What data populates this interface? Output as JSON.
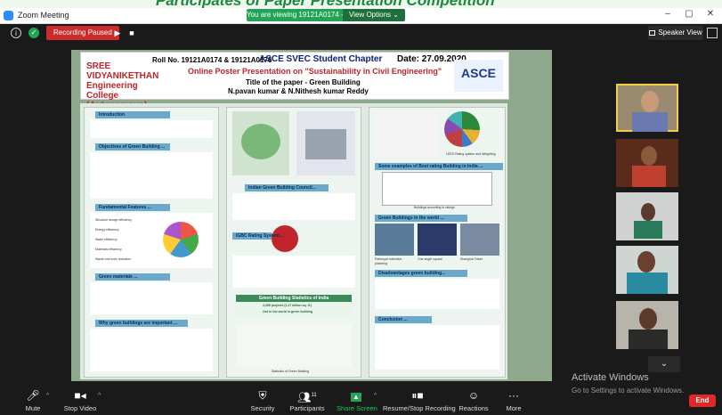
{
  "banner": {
    "text": "Participates of Paper Presentation Competition"
  },
  "titlebar": {
    "app_title": "Zoom Meeting",
    "minimize": "–",
    "restore": "▢",
    "close": "✕"
  },
  "share_bar": {
    "viewing_text": "You are viewing 19121A0174 - Pavan's screen",
    "view_options": "View Options ⌄"
  },
  "topbar": {
    "info": "i",
    "shield": "✓",
    "recording": "Recording Paused",
    "resume": "▶",
    "stop": "■",
    "speaker_view": "Speaker View"
  },
  "poster": {
    "header": {
      "logo_left": "SREE VIDYANIKETHAN Engineering College (Autonomous)",
      "roll_no": "Roll No. 19121A0174 & 19121A0176",
      "chapter": "ASCE SVEC Student Chapter",
      "date": "Date: 27.09.2020",
      "online": "Online Poster Presentation on \"Sustainability in Civil Engineering\"",
      "paper_title": "Title of the paper - Green Building",
      "authors": "N.pavan kumar & N.Nithesh kumar Reddy",
      "logo_right": "ASCE"
    },
    "sections": {
      "introduction": "Introduction",
      "objectives": "Objectives of Green Building ...",
      "fundamental": "Fundamental Features ...",
      "materials": "Green materials ...",
      "why": "Why green buildings are important ...",
      "benefits": "Benefits of green Building",
      "igbc": "Indian Green Building Council...",
      "rating": "IGBC Rating System...",
      "statistics": "Green Building Statistics of India",
      "examples": "Some examples of Best rating Building in India ...",
      "world": "Green Buildings in the world ...",
      "disadvantages": "Disadvantages green building...",
      "conclusion": "Conclusion ..."
    },
    "features": [
      "Structure design efficiency",
      "Energy efficiency",
      "Water efficiency",
      "Materials efficiency",
      "Waste and toxic reduction"
    ],
    "world_captions": [
      "Parkroyal collection pickering",
      "One angel square",
      "Shanghai Tower"
    ],
    "chart_caption": "LEED Rating system and Weighting",
    "table_caption": "Buildings according to ratings",
    "stats_line1": "4,358 projects (1.47 billion sq. ft.)",
    "stats_line2": "2nd in the world in green building",
    "stats_footer": "Statistics of Green Building"
  },
  "gallery": {
    "expand": "⌄"
  },
  "watermark": {
    "line1": "Activate Windows",
    "line2": "Go to Settings to activate Windows."
  },
  "toolbar": {
    "mute": "Mute",
    "stop_video": "Stop Video",
    "security": "Security",
    "participants": "Participants",
    "participants_count": "11",
    "share_screen": "Share Screen",
    "recording": "Resume/Stop Recording",
    "reactions": "Reactions",
    "more": "More",
    "end": "End"
  },
  "colors": {
    "share_green": "#23a455",
    "end_red": "#e02828",
    "record_red": "#cc2b2b",
    "banner_green": "#1a8a3a"
  }
}
